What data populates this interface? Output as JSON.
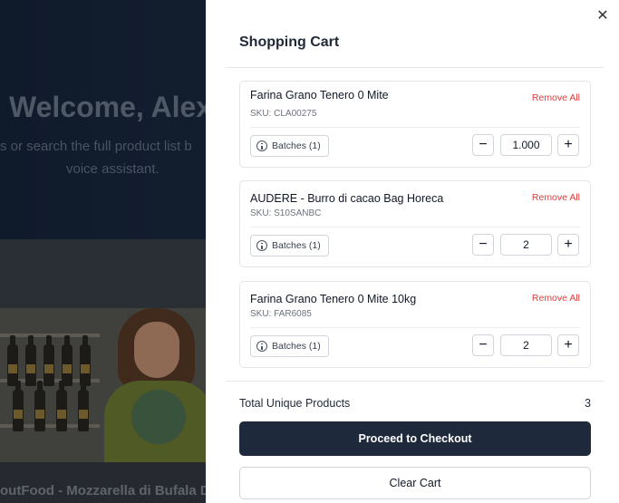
{
  "background": {
    "hero_title": "Welcome, Alex",
    "hero_subtitle_line1": "s or search the full product list b",
    "hero_subtitle_line2": "voice assistant.",
    "product_caption": "outFood - Mozzarella di Bufala DO"
  },
  "cart": {
    "title": "Shopping Cart",
    "close_icon": "close-icon",
    "items": [
      {
        "name": "Farina Grano Tenero 0 Mite",
        "sku": "SKU: CLA00275",
        "remove_label": "Remove All",
        "batches_label": "Batches (1)",
        "quantity": "1.000"
      },
      {
        "name": "AUDERE - Burro di cacao Bag Horeca",
        "sku": "SKU: S10SANBC",
        "remove_label": "Remove All",
        "batches_label": "Batches (1)",
        "quantity": "2"
      },
      {
        "name": "Farina Grano Tenero 0 Mite 10kg",
        "sku": "SKU: FAR6085",
        "remove_label": "Remove All",
        "batches_label": "Batches (1)",
        "quantity": "2"
      }
    ],
    "minus_symbol": "−",
    "plus_symbol": "+",
    "total_label": "Total Unique Products",
    "total_value": "3",
    "checkout_label": "Proceed to Checkout",
    "clear_label": "Clear Cart"
  },
  "colors": {
    "primary": "#1e293b",
    "danger": "#e33b3b"
  }
}
